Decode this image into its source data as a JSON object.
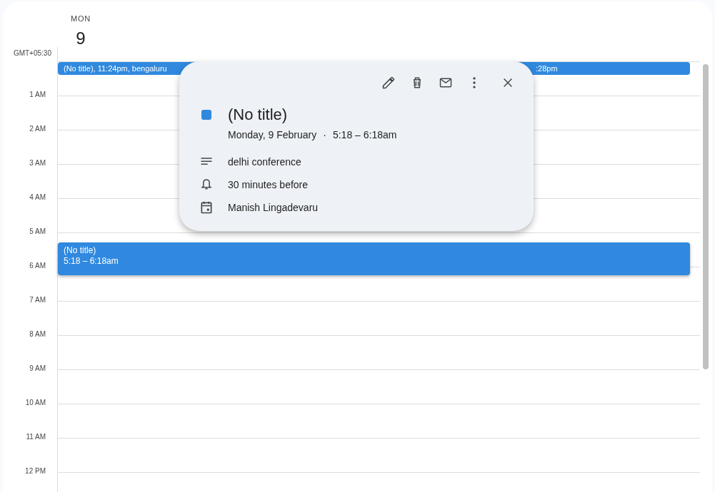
{
  "day": {
    "weekday": "MON",
    "date": "9"
  },
  "timezone": "GMT+05:30",
  "top_row_events": [
    {
      "text": "(No title), 11:24pm, bengaluru"
    },
    {
      "text": ":28pm"
    }
  ],
  "hours": [
    "1 AM",
    "2 AM",
    "3 AM",
    "4 AM",
    "5 AM",
    "6 AM",
    "7 AM",
    "8 AM",
    "9 AM",
    "10 AM",
    "11 AM",
    "12 PM"
  ],
  "events": [
    {
      "title": "(No title)",
      "time": "5:18 – 6:18am"
    }
  ],
  "popup": {
    "title": "(No title)",
    "date": "Monday, 9 February",
    "separator": "·",
    "time": "5:18 – 6:18am",
    "details": [
      {
        "kind": "description",
        "text": "delhi conference"
      },
      {
        "kind": "reminder",
        "text": "30 minutes before"
      },
      {
        "kind": "calendar",
        "text": "Manish Lingadevaru"
      }
    ]
  }
}
